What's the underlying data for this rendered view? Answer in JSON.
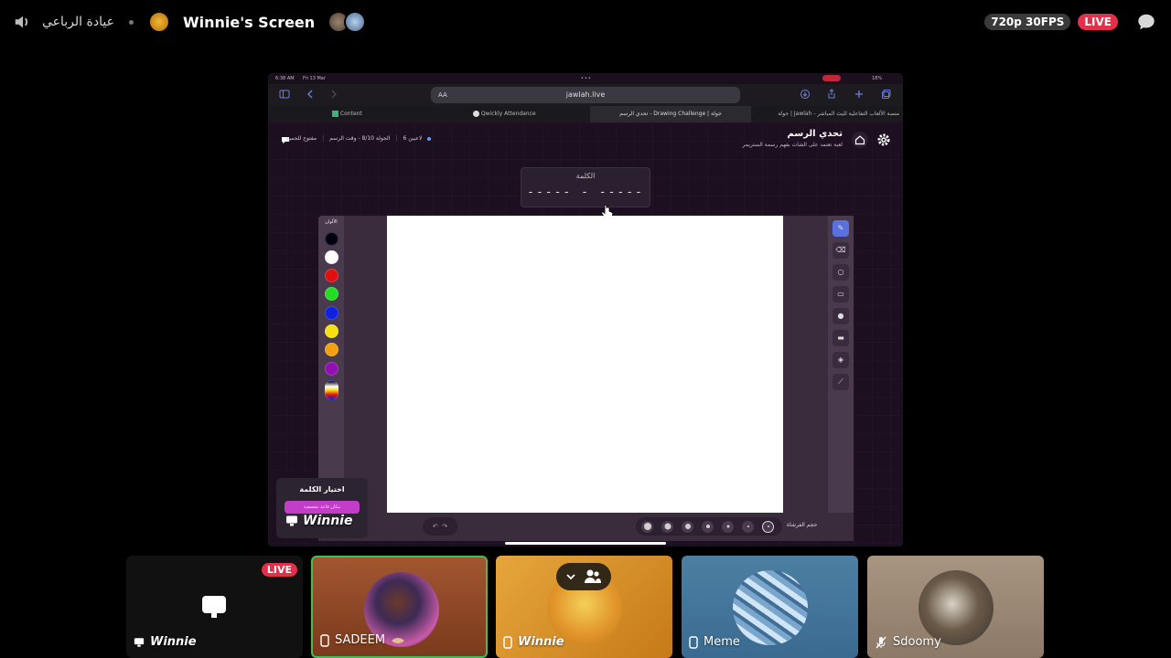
{
  "topbar": {
    "channel": "عيادة الرباعي",
    "screen_title": "Winnie's Screen",
    "quality": "720p 30FPS",
    "live": "LIVE"
  },
  "stream": {
    "status": {
      "time": "6:38 AM",
      "date": "Fri 13 Mar",
      "battery": "18%"
    },
    "browser": {
      "url": "jawlah.live",
      "aa": "AA"
    },
    "tabs": [
      "Content",
      "Qwickly Attendance",
      "تحدي الرسم - Drawing Challenge | جولة",
      "جولة | Jawlah - منصة الألعاب التفاعلية لليث المباشر"
    ],
    "app": {
      "title": "تحدي الرسم",
      "subtitle": "لعبة تعتمد على الشات بفهم رسمة الستريمر",
      "stats": {
        "players": "6 لاعبين",
        "round": "الجولة 8/10 - وقت الرسم",
        "mode": "مفتوح للجميع"
      },
      "word_label": "الكلمة",
      "word_mask": "----- - -----",
      "colors_label": "الألوان",
      "brush_label": "حجم الفرشاة",
      "pick_title": "اختيار الكلمة",
      "pick_button": "مكان قاعة مقصصة",
      "watermark": "Winnie"
    },
    "palette": [
      "#000010",
      "#ffffff",
      "#e01010",
      "#22dd22",
      "#1020e0",
      "#f4e010",
      "#f0a010",
      "#9010b0",
      "multicolor"
    ]
  },
  "participants": [
    {
      "name": "Winnie",
      "live": "LIVE",
      "device": "screen"
    },
    {
      "name": "SADEEM",
      "device": "phone",
      "active": true
    },
    {
      "name": "Winnie",
      "device": "phone"
    },
    {
      "name": "Meme",
      "device": "phone"
    },
    {
      "name": "Sdoomy",
      "device": "muted"
    }
  ]
}
